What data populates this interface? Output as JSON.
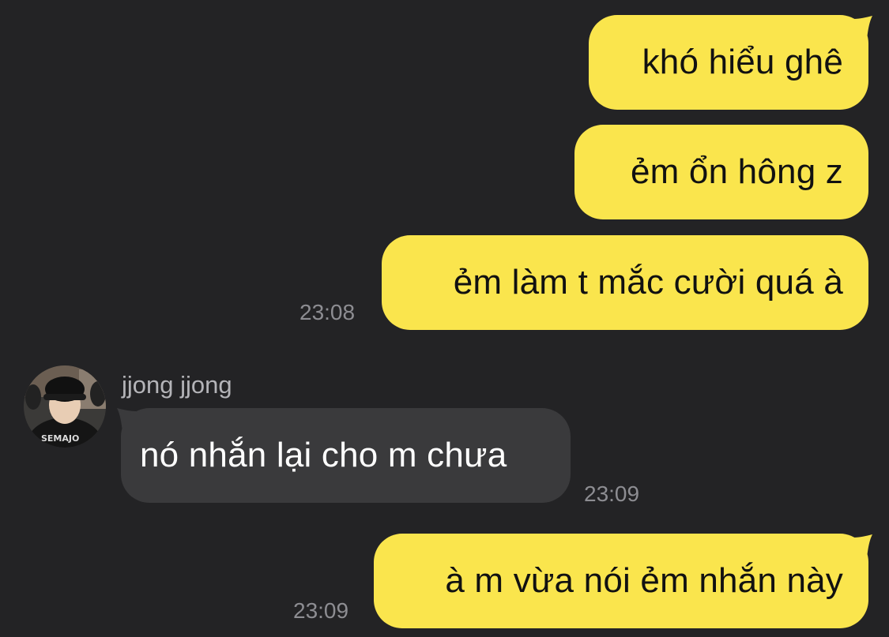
{
  "colors": {
    "background": "#232325",
    "outgoing_bubble": "#FAE54D",
    "incoming_bubble": "#3A3A3C",
    "timestamp": "#8D8D92",
    "sender_name": "#B4B4B8"
  },
  "messages": [
    {
      "direction": "outgoing",
      "text": "khó hiểu ghê"
    },
    {
      "direction": "outgoing",
      "text": "ẻm ổn hông z"
    },
    {
      "direction": "outgoing",
      "text": "ẻm làm t mắc cười quá à",
      "time": "23:08"
    },
    {
      "direction": "incoming",
      "sender": "jjong jjong",
      "avatar": "profile-photo",
      "text": "nó nhắn lại cho m chưa",
      "time": "23:09"
    },
    {
      "direction": "outgoing",
      "text": "à m vừa nói ẻm nhắn này",
      "time": "23:09"
    }
  ]
}
